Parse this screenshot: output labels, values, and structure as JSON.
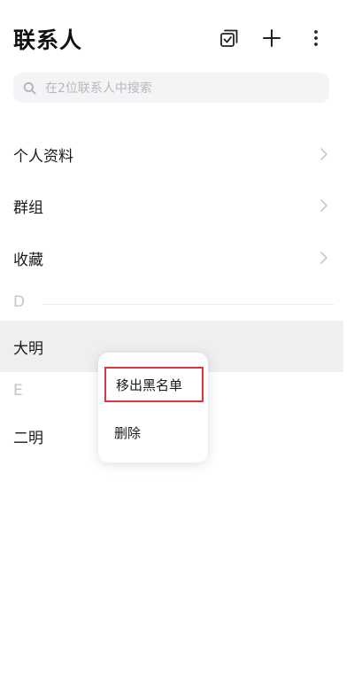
{
  "header": {
    "title": "联系人",
    "icons": [
      "multi-select-icon",
      "plus-icon",
      "more-vertical-icon"
    ]
  },
  "search": {
    "placeholder": "在2位联系人中搜索",
    "icon": "search-icon"
  },
  "menu_rows": [
    {
      "label": "个人资料"
    },
    {
      "label": "群组"
    },
    {
      "label": "收藏"
    }
  ],
  "sections": [
    {
      "letter": "D",
      "contacts": [
        "大明"
      ]
    },
    {
      "letter": "E",
      "contacts": [
        "二明"
      ]
    }
  ],
  "context_menu": {
    "items": [
      {
        "label": "移出黑名单"
      },
      {
        "label": "删除"
      }
    ],
    "highlight_color": "#d9363e"
  }
}
